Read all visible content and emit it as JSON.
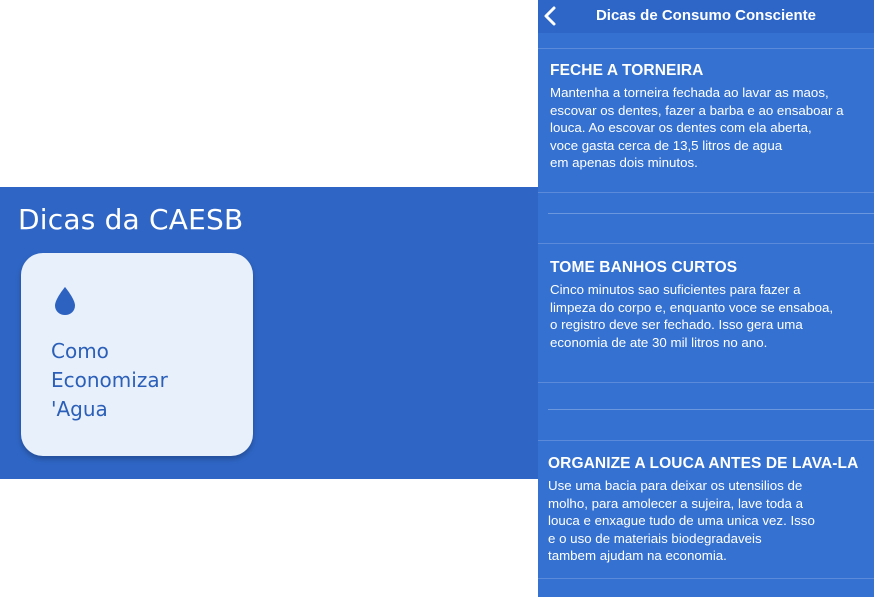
{
  "widget": {
    "title": "Dicas da CAESB",
    "tile_label": "Como\nEconomizar\n'Agua",
    "tile_icon": "water-drop-icon"
  },
  "screen": {
    "back_icon": "chevron-left-icon",
    "title": "Dicas de Consumo Consciente",
    "tips": [
      {
        "title": "FECHE A TORNEIRA",
        "lines": [
          "Mantenha a torneira fechada ao lavar as maos,",
          "escovar os dentes, fazer a barba e ao ensaboar a",
          "louca. Ao escovar os dentes com ela aberta,",
          "voce gasta cerca de 13,5 litros de agua",
          "em apenas dois minutos."
        ]
      },
      {
        "title": "TOME BANHOS CURTOS",
        "lines": [
          "Cinco minutos sao suficientes para fazer a",
          "limpeza do corpo e, enquanto voce se ensaboa,",
          "o registro deve ser fechado. Isso gera uma",
          "economia de ate 30 mil litros no ano."
        ]
      },
      {
        "title": "ORGANIZE A LOUCA ANTES DE LAVA-LA",
        "lines": [
          "Use uma bacia para deixar os utensilios de",
          "molho, para amolecer a sujeira, lave toda a",
          "louca e enxague tudo de uma unica vez. Isso",
          "e o uso de materiais biodegradaveis",
          "tambem ajudam na economia."
        ]
      }
    ]
  },
  "colors": {
    "panel_blue": "#2f66c6",
    "screen_blue": "#3571d0",
    "tile_bg": "#e8f0fb",
    "tile_text": "#2b5fb8"
  }
}
